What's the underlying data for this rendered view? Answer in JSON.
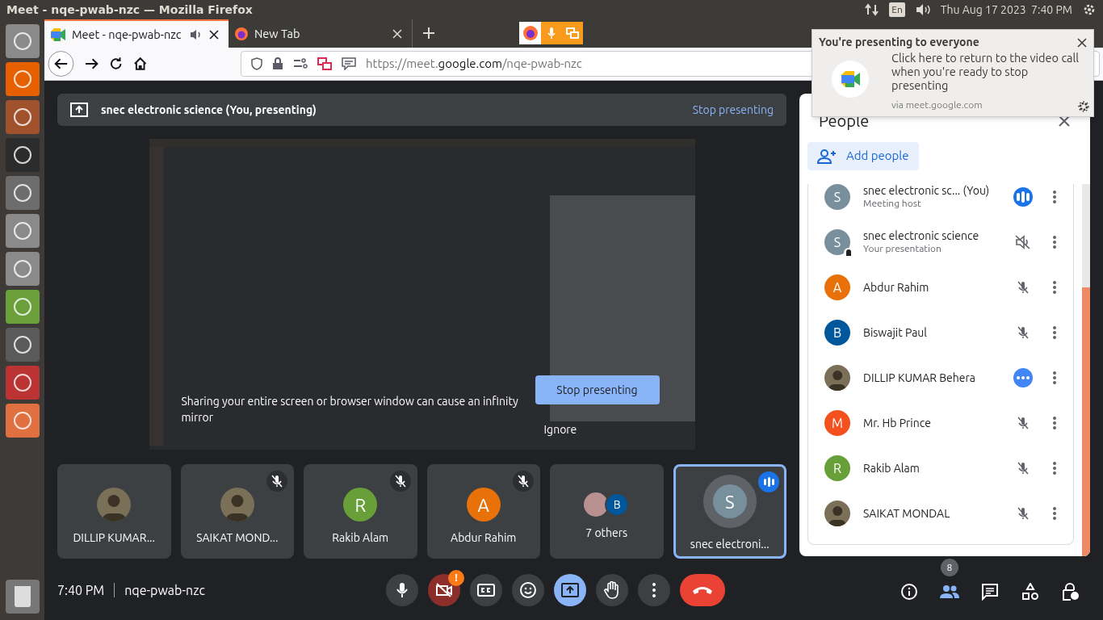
{
  "system_bar": {
    "title": "Meet - nqe-pwab-nzc — Mozilla Firefox",
    "keyboard": "En",
    "datetime": "Thu Aug 17 2023  7:40 PM"
  },
  "tabs": [
    {
      "label": "Meet - nqe-pwab-nzc",
      "selected": true,
      "audio": true,
      "favicon": {
        "kind": "meet"
      }
    },
    {
      "label": "New Tab",
      "selected": false,
      "audio": false,
      "favicon": {
        "kind": "firefox"
      }
    }
  ],
  "address": {
    "url": [
      {
        "text": "https://meet.",
        "strong": false
      },
      {
        "text": "google.com",
        "strong": true
      },
      {
        "text": "/nqe-pwab-nzc",
        "strong": false
      }
    ]
  },
  "notification": {
    "title": "You're presenting to everyone",
    "body": "Click here to return to the video call when you're ready to stop presenting",
    "source": "via meet.google.com"
  },
  "presenting_bar": {
    "title": "snec electronic science (You, presenting)",
    "action": "Stop presenting"
  },
  "mirror_overlay": {
    "warning": "Sharing your entire screen or browser window can cause an infinity mirror",
    "stop_button": "Stop presenting",
    "ignore_button": "Ignore"
  },
  "tiles": [
    {
      "name": "DILLIP KUMAR...",
      "avatar": {
        "kind": "photo"
      },
      "muted": false,
      "speaking": false,
      "selected": false
    },
    {
      "name": "SAIKAT MOND...",
      "avatar": {
        "kind": "photo"
      },
      "muted": true,
      "speaking": false,
      "selected": false
    },
    {
      "name": "Rakib Alam",
      "avatar": {
        "kind": "letter",
        "letter": "R",
        "color": "#689f38"
      },
      "muted": true,
      "speaking": false,
      "selected": false
    },
    {
      "name": "Abdur Rahim",
      "avatar": {
        "kind": "letter",
        "letter": "A",
        "color": "#e8710a"
      },
      "muted": true,
      "speaking": false,
      "selected": false
    },
    {
      "name": "7 others",
      "avatar": {
        "kind": "group",
        "letter": "B",
        "color": "#01579b"
      },
      "muted": false,
      "speaking": false,
      "selected": false
    },
    {
      "name": "snec electroni...",
      "avatar": {
        "kind": "letter",
        "letter": "S",
        "color": "#78909c"
      },
      "muted": false,
      "speaking": true,
      "selected": true
    }
  ],
  "call_info": {
    "time": "7:40 PM",
    "code": "nqe-pwab-nzc"
  },
  "controls": [
    {
      "kind": "mic",
      "selected": false
    },
    {
      "kind": "camera",
      "badge": "!",
      "selected": false
    },
    {
      "kind": "captions",
      "selected": false
    },
    {
      "kind": "emoji",
      "selected": false
    },
    {
      "kind": "present",
      "selected": true
    },
    {
      "kind": "hand",
      "selected": false
    },
    {
      "kind": "more",
      "selected": false
    },
    {
      "kind": "end",
      "selected": false
    }
  ],
  "side_controls": [
    {
      "kind": "info",
      "selected": false
    },
    {
      "kind": "people",
      "badge": "8",
      "selected": true
    },
    {
      "kind": "chat",
      "selected": false
    },
    {
      "kind": "activities",
      "selected": false
    },
    {
      "kind": "host",
      "selected": false
    }
  ],
  "people_panel": {
    "title": "People",
    "add_button": "Add people",
    "participants": [
      {
        "name": "snec electronic sc... (You)",
        "subtitle": "Meeting host",
        "avatar": {
          "kind": "letter",
          "letter": "S",
          "color": "#78909c"
        },
        "indicator": {
          "kind": "speaking"
        },
        "pinned": false
      },
      {
        "name": "snec electronic science",
        "subtitle": "Your presentation",
        "avatar": {
          "kind": "letter",
          "letter": "S",
          "color": "#78909c"
        },
        "indicator": {
          "kind": "audio_off"
        },
        "pinned": true
      },
      {
        "name": "Abdur Rahim",
        "avatar": {
          "kind": "letter",
          "letter": "A",
          "color": "#e8710a"
        },
        "indicator": {
          "kind": "muted"
        },
        "pinned": false
      },
      {
        "name": "Biswajit Paul",
        "avatar": {
          "kind": "letter",
          "letter": "B",
          "color": "#01579b"
        },
        "indicator": {
          "kind": "muted"
        },
        "pinned": false
      },
      {
        "name": "DILLIP KUMAR Behera",
        "avatar": {
          "kind": "photo"
        },
        "indicator": {
          "kind": "more"
        },
        "pinned": false
      },
      {
        "name": "Mr. Hb Prince",
        "avatar": {
          "kind": "letter",
          "letter": "M",
          "color": "#f4511e"
        },
        "indicator": {
          "kind": "muted"
        },
        "pinned": false
      },
      {
        "name": "Rakib Alam",
        "avatar": {
          "kind": "letter",
          "letter": "R",
          "color": "#689f38"
        },
        "indicator": {
          "kind": "muted"
        },
        "pinned": false
      },
      {
        "name": "SAIKAT MONDAL",
        "avatar": {
          "kind": "photo"
        },
        "indicator": {
          "kind": "muted"
        },
        "pinned": false
      }
    ]
  }
}
